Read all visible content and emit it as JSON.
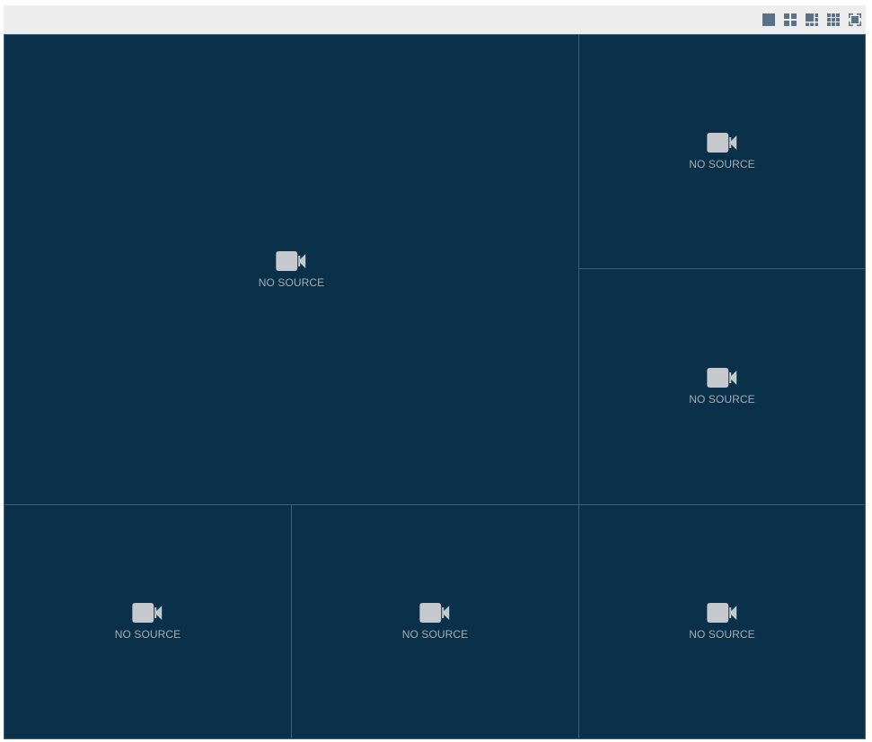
{
  "toolbar": {
    "buttons": [
      {
        "icon": "layout-single-icon"
      },
      {
        "icon": "layout-2x2-icon"
      },
      {
        "icon": "layout-1plus5-icon"
      },
      {
        "icon": "layout-3x3-icon"
      },
      {
        "icon": "fullscreen-icon"
      }
    ]
  },
  "cells": [
    {
      "label": "NO SOURCE",
      "icon": "video-camera-icon"
    },
    {
      "label": "NO SOURCE",
      "icon": "video-camera-icon"
    },
    {
      "label": "NO SOURCE",
      "icon": "video-camera-icon"
    },
    {
      "label": "NO SOURCE",
      "icon": "video-camera-icon"
    },
    {
      "label": "NO SOURCE",
      "icon": "video-camera-icon"
    },
    {
      "label": "NO SOURCE",
      "icon": "video-camera-icon"
    }
  ],
  "colors": {
    "cell_background": "#0a3149",
    "icon": "#c5c8cc",
    "toolbar_icon": "#5a7188"
  }
}
